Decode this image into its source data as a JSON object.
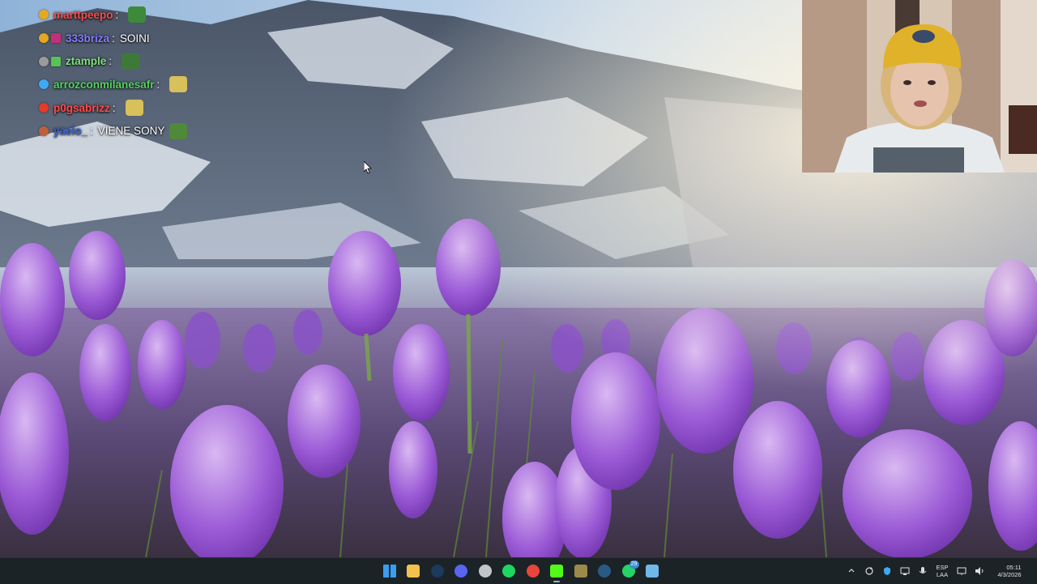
{
  "chat": [
    {
      "username": "marttpeepo",
      "color": "#ff4b4b",
      "badges": [
        "#e6a820"
      ],
      "message": "",
      "emote": "#3d8a3a"
    },
    {
      "username": "333briza",
      "color": "#8a7cff",
      "badges": [
        "#e6a820",
        "#c2307a"
      ],
      "message": "SOINI",
      "emote": ""
    },
    {
      "username": "ztample",
      "color": "#7fe07f",
      "badges": [
        "#9a9a9a",
        "#55c455"
      ],
      "message": "",
      "emote": "#3d7a3a"
    },
    {
      "username": "arrozconmilanesafr",
      "color": "#4fd35f",
      "badges": [
        "#3fa9f5"
      ],
      "message": "",
      "emote": "#d8c05a"
    },
    {
      "username": "p0gsabrizz",
      "color": "#ff4b4b",
      "badges": [
        "#e63a2a"
      ],
      "message": "",
      "emote": "#d8c05a"
    },
    {
      "username": "yaelo_",
      "color": "#3a63d6",
      "badges": [
        "#c0603a"
      ],
      "message": "VIENE SONY",
      "emote": "#4f8a3a"
    }
  ],
  "taskbar": {
    "apps": [
      {
        "name": "start-button",
        "color": "#3a9ef0",
        "active": false,
        "badge": ""
      },
      {
        "name": "file-explorer-icon",
        "color": "#f2c14e",
        "active": false,
        "badge": ""
      },
      {
        "name": "steam-icon",
        "color": "#1b3a5c",
        "active": false,
        "badge": ""
      },
      {
        "name": "discord-icon",
        "color": "#5865f2",
        "active": false,
        "badge": ""
      },
      {
        "name": "app-icon",
        "color": "#c0c6ca",
        "active": false,
        "badge": ""
      },
      {
        "name": "spotify-icon",
        "color": "#1ed760",
        "active": false,
        "badge": ""
      },
      {
        "name": "chrome-icon",
        "color": "#e8453c",
        "active": false,
        "badge": ""
      },
      {
        "name": "kick-icon",
        "color": "#53fc18",
        "active": true,
        "badge": ""
      },
      {
        "name": "game-icon",
        "color": "#9b8a4a",
        "active": false,
        "badge": ""
      },
      {
        "name": "steam-icon-2",
        "color": "#2a5a84",
        "active": false,
        "badge": ""
      },
      {
        "name": "whatsapp-icon",
        "color": "#25d366",
        "active": false,
        "badge": "29"
      },
      {
        "name": "notepad-icon",
        "color": "#6fb8e8",
        "active": false,
        "badge": ""
      }
    ],
    "tray": {
      "language_line1": "ESP",
      "language_line2": "LAA",
      "time": "05:11",
      "date": "4/3/2026"
    }
  }
}
